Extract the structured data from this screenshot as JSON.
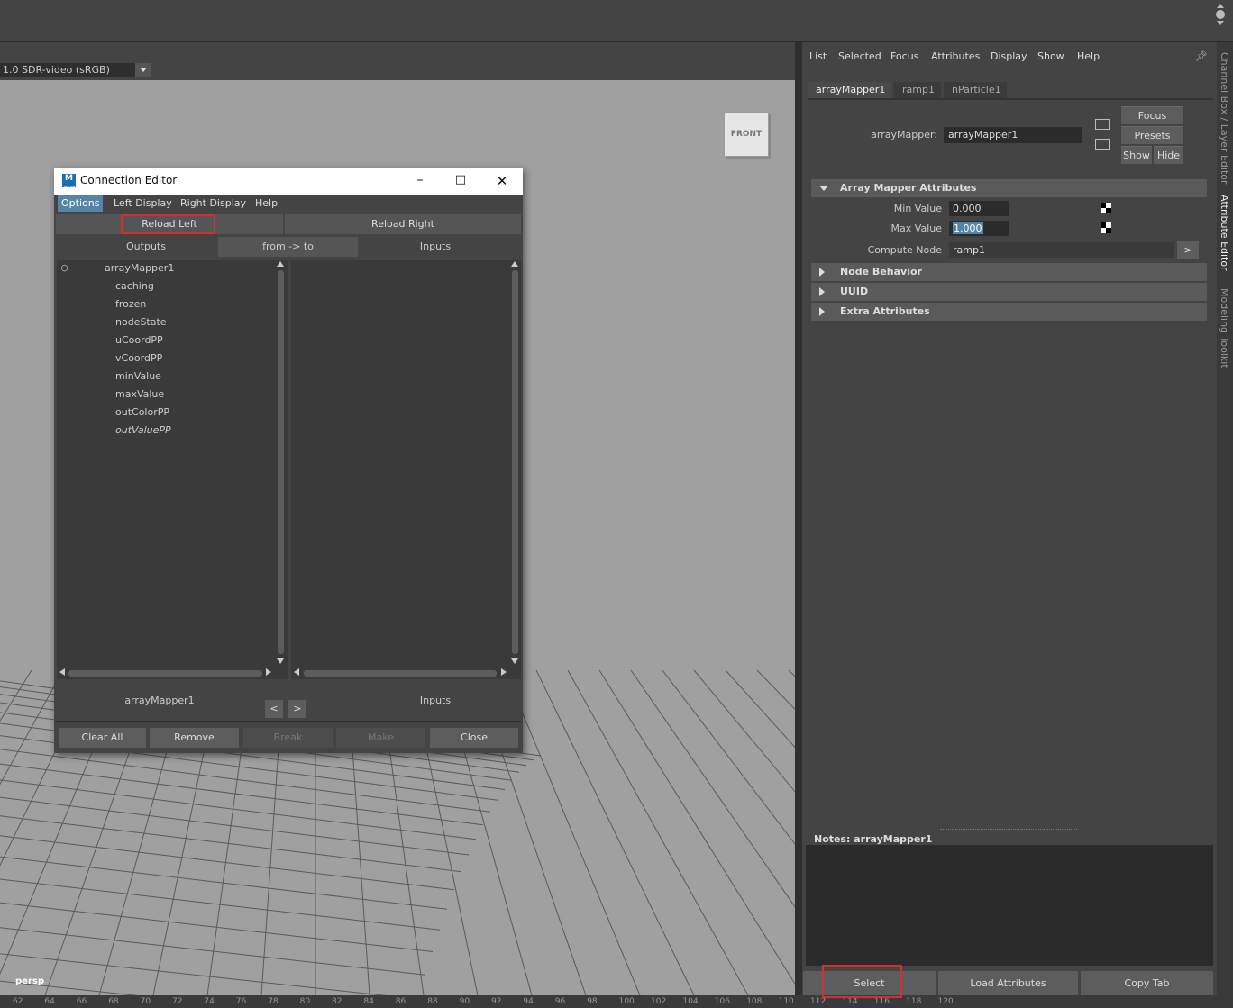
{
  "viewport": {
    "color_space": "1.0 SDR-video (sRGB)",
    "view_cube_label": "FRONT",
    "camera_label": "persp",
    "timeline_ticks": [
      "62",
      "64",
      "66",
      "68",
      "70",
      "72",
      "74",
      "76",
      "78",
      "80",
      "82",
      "84",
      "86",
      "88",
      "90",
      "92",
      "94",
      "96",
      "98",
      "100",
      "102",
      "104",
      "106",
      "108",
      "110",
      "112",
      "114",
      "116",
      "118",
      "120"
    ]
  },
  "attribute_editor": {
    "menu": [
      "List",
      "Selected",
      "Focus",
      "Attributes",
      "Display",
      "Show",
      "Help"
    ],
    "tabs": [
      "arrayMapper1",
      "ramp1",
      "nParticle1"
    ],
    "node_type_label": "arrayMapper:",
    "node_name": "arrayMapper1",
    "buttons": {
      "focus": "Focus",
      "presets": "Presets",
      "show": "Show",
      "hide": "Hide"
    },
    "section_array_mapper": "Array Mapper Attributes",
    "min_value_label": "Min Value",
    "min_value": "0.000",
    "max_value_label": "Max Value",
    "max_value": "1.000",
    "compute_node_label": "Compute Node",
    "compute_node": "ramp1",
    "compute_node_btn": ">",
    "section_node_behavior": "Node Behavior",
    "section_uuid": "UUID",
    "section_extra": "Extra Attributes",
    "notes_label": "Notes:  arrayMapper1",
    "bottom_buttons": {
      "select": "Select",
      "load_attributes": "Load Attributes",
      "copy_tab": "Copy Tab"
    }
  },
  "side_tabs": [
    "Channel Box / Layer Editor",
    "Attribute Editor",
    "Modeling Toolkit"
  ],
  "connection_editor": {
    "title": "Connection Editor",
    "menu": [
      "Options",
      "Left Display",
      "Right Display",
      "Help"
    ],
    "reload_left": "Reload Left",
    "reload_right": "Reload Right",
    "outputs_header": "Outputs",
    "direction": "from -> to",
    "inputs_header": "Inputs",
    "left_root": "arrayMapper1",
    "left_items": [
      "caching",
      "frozen",
      "nodeState",
      "uCoordPP",
      "vCoordPP",
      "minValue",
      "maxValue",
      "outColorPP",
      "outValuePP"
    ],
    "footer_left": "arrayMapper1",
    "footer_right": "Inputs",
    "nav_left": "<",
    "nav_right": ">",
    "bottom_buttons": {
      "clear_all": "Clear All",
      "remove": "Remove",
      "break": "Break",
      "make": "Make",
      "close": "Close"
    }
  },
  "colors": {
    "highlight": "#d32f2f",
    "menu_active": "#5285a6"
  }
}
